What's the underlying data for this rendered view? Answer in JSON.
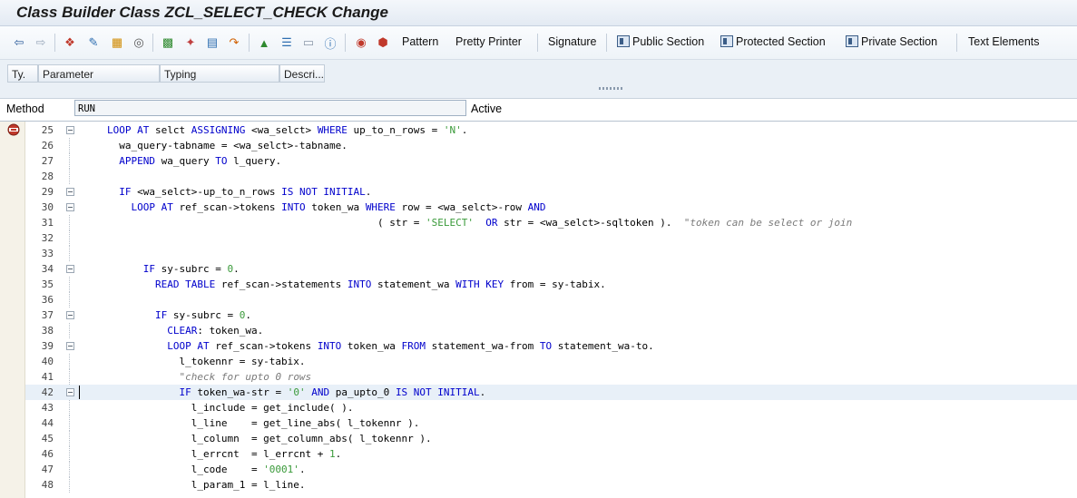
{
  "window": {
    "title": "Class Builder Class ZCL_SELECT_CHECK Change"
  },
  "toolbar": {
    "pattern": "Pattern",
    "pretty_printer": "Pretty Printer",
    "signature": "Signature",
    "public_section": "Public Section",
    "protected_section": "Protected Section",
    "private_section": "Private Section",
    "text_elements": "Text Elements"
  },
  "params": {
    "columns": [
      "Ty.",
      "Parameter",
      "Typing",
      "Descri..."
    ]
  },
  "method": {
    "label": "Method",
    "value": "RUN",
    "status": "Active"
  },
  "editor": {
    "lines": [
      {
        "num": "25",
        "text": "LOOP AT selct ASSIGNING <wa_selct> WHERE up_to_n_rows = 'N'."
      },
      {
        "num": "26",
        "text": "  wa_query-tabname = <wa_selct>-tabname."
      },
      {
        "num": "27",
        "text": "  APPEND wa_query TO l_query."
      },
      {
        "num": "28",
        "text": ""
      },
      {
        "num": "29",
        "text": "  IF <wa_selct>-up_to_n_rows IS NOT INITIAL."
      },
      {
        "num": "30",
        "text": "    LOOP AT ref_scan->tokens INTO token_wa WHERE row = <wa_selct>-row AND"
      },
      {
        "num": "31",
        "text": "                                             ( str = 'SELECT'  OR str = <wa_selct>-sqltoken ).  \"token can be select or join"
      },
      {
        "num": "32",
        "text": ""
      },
      {
        "num": "33",
        "text": ""
      },
      {
        "num": "34",
        "text": "      IF sy-subrc = 0."
      },
      {
        "num": "35",
        "text": "        READ TABLE ref_scan->statements INTO statement_wa WITH KEY from = sy-tabix."
      },
      {
        "num": "36",
        "text": ""
      },
      {
        "num": "37",
        "text": "        IF sy-subrc = 0."
      },
      {
        "num": "38",
        "text": "          CLEAR: token_wa."
      },
      {
        "num": "39",
        "text": "          LOOP AT ref_scan->tokens INTO token_wa FROM statement_wa-from TO statement_wa-to."
      },
      {
        "num": "40",
        "text": "            l_tokennr = sy-tabix."
      },
      {
        "num": "41",
        "text": "            \"check for upto 0 rows"
      },
      {
        "num": "42",
        "text": "            IF token_wa-str = '0' AND pa_upto_0 IS NOT INITIAL."
      },
      {
        "num": "43",
        "text": "              l_include = get_include( )."
      },
      {
        "num": "44",
        "text": "              l_line    = get_line_abs( l_tokennr )."
      },
      {
        "num": "45",
        "text": "              l_column  = get_column_abs( l_tokennr )."
      },
      {
        "num": "46",
        "text": "              l_errcnt  = l_errcnt + 1."
      },
      {
        "num": "47",
        "text": "              l_code    = '0001'."
      },
      {
        "num": "48",
        "text": "              l_param_1 = l_line."
      }
    ]
  }
}
